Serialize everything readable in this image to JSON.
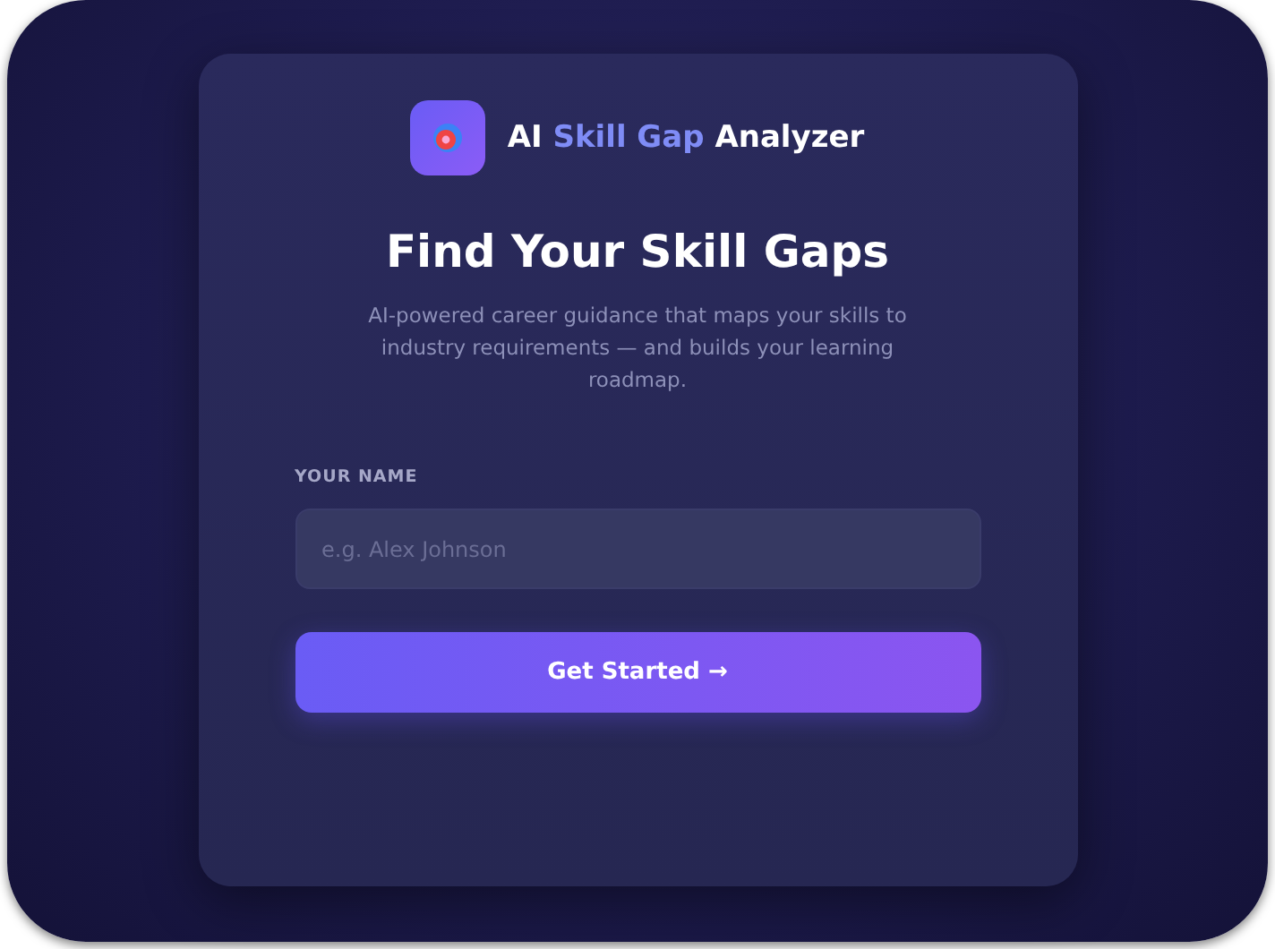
{
  "brand": {
    "parts": [
      {
        "text": "AI ",
        "accent": false
      },
      {
        "text": "Skill Gap",
        "accent": true
      },
      {
        "text": " Analyzer",
        "accent": false
      }
    ]
  },
  "heading": "Find Your Skill Gaps",
  "description": "AI-powered career guidance that maps your skills to industry requirements — and builds your learning roadmap.",
  "name_field": {
    "label": "YOUR NAME",
    "placeholder": "e.g. Alex Johnson"
  },
  "button": "Get Started →"
}
